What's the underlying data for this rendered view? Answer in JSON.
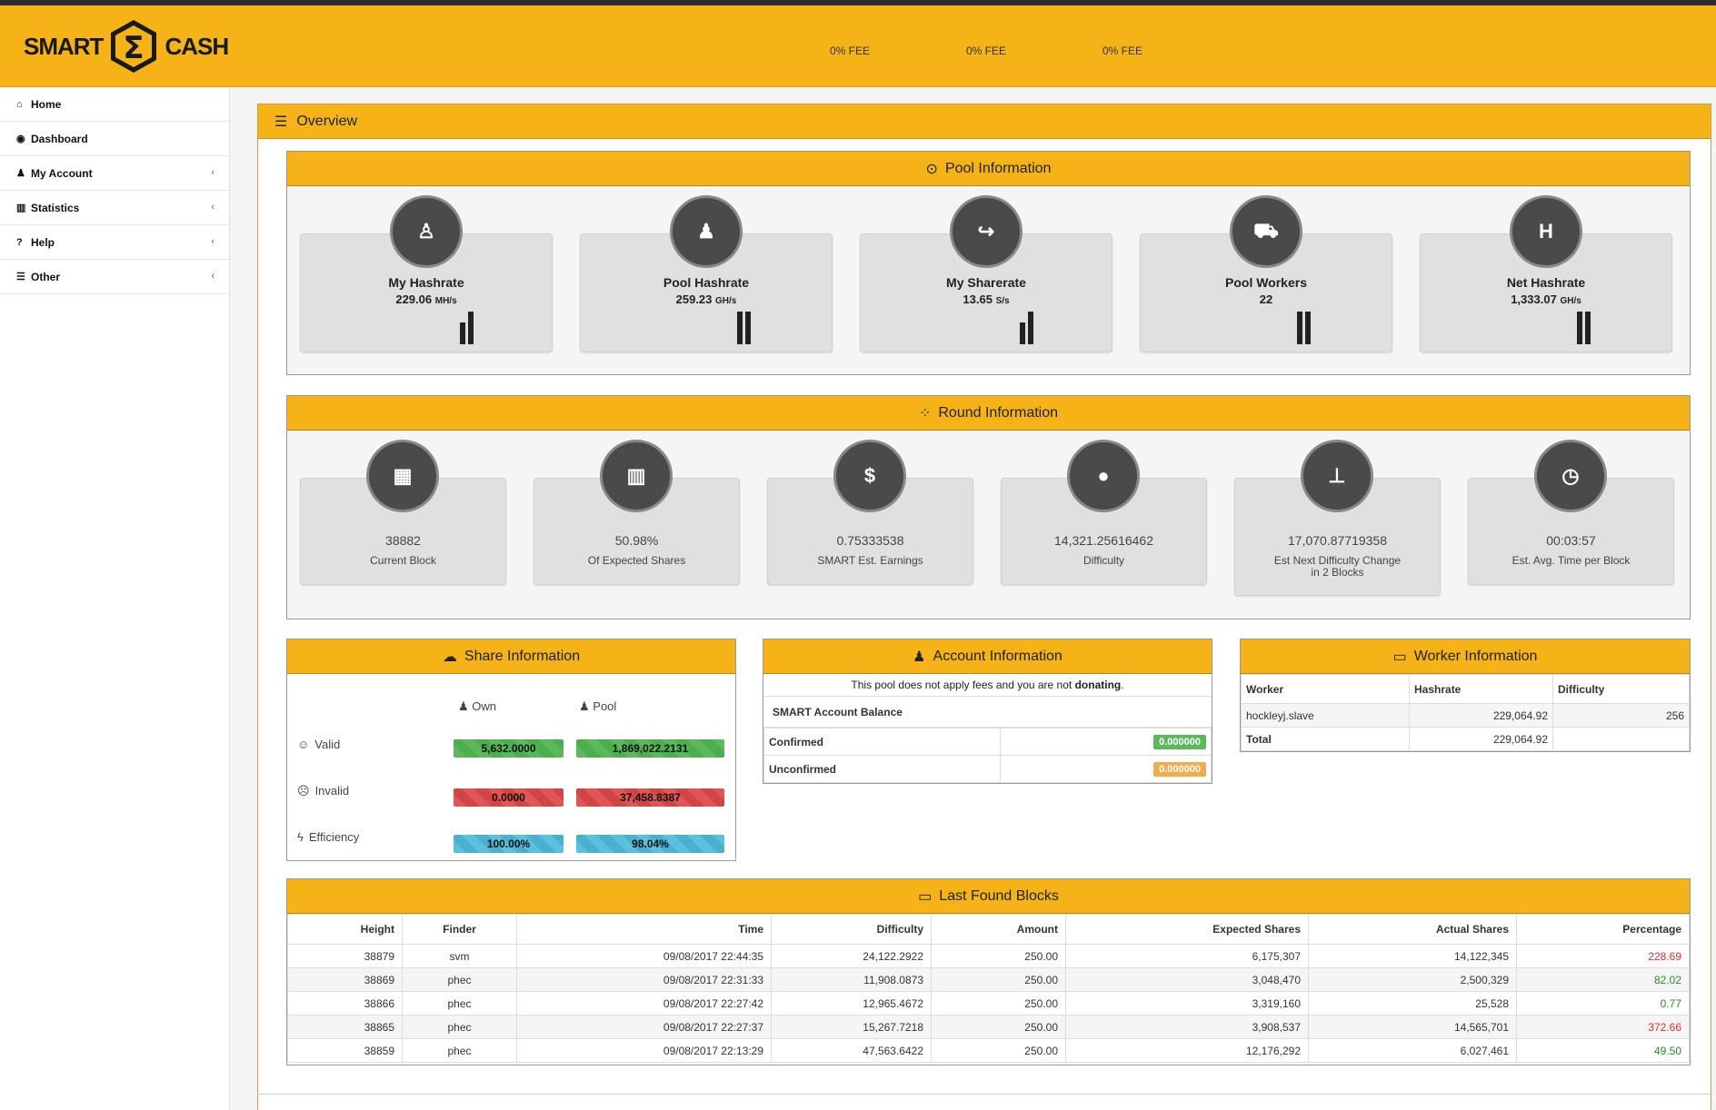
{
  "header": {
    "logo_left": "SMART",
    "logo_symbol": "Σ",
    "logo_right": "CASH",
    "fees": [
      "0% FEE",
      "0% FEE",
      "0% FEE"
    ]
  },
  "sidebar": {
    "items": [
      {
        "label": "Home",
        "icon": "home-icon",
        "glyph": "⌂",
        "chevron": false
      },
      {
        "label": "Dashboard",
        "icon": "dashboard-icon",
        "glyph": "◉",
        "chevron": false
      },
      {
        "label": "My Account",
        "icon": "user-money-icon",
        "glyph": "♟",
        "chevron": true
      },
      {
        "label": "Statistics",
        "icon": "bar-chart-icon",
        "glyph": "▥",
        "chevron": true
      },
      {
        "label": "Help",
        "icon": "question-icon",
        "glyph": "?",
        "chevron": true
      },
      {
        "label": "Other",
        "icon": "list-icon",
        "glyph": "☰",
        "chevron": true
      }
    ],
    "chevron_glyph": "‹"
  },
  "overview": {
    "title": "Overview"
  },
  "pool_info": {
    "title": "Pool Information",
    "tiles": [
      {
        "title": "My Hashrate",
        "value": "229.06",
        "unit": "MH/s",
        "icon": "male-icon",
        "glyph": "♙"
      },
      {
        "title": "Pool Hashrate",
        "value": "259.23",
        "unit": "GH/s",
        "icon": "users-icon",
        "glyph": "♟"
      },
      {
        "title": "My Sharerate",
        "value": "13.65",
        "unit": "S/s",
        "icon": "share-icon",
        "glyph": "↪"
      },
      {
        "title": "Pool Workers",
        "value": "22",
        "unit": "",
        "icon": "truck-icon",
        "glyph": "⛟"
      },
      {
        "title": "Net Hashrate",
        "value": "1,333.07",
        "unit": "GH/s",
        "icon": "h-square-icon",
        "glyph": "H"
      }
    ]
  },
  "round_info": {
    "title": "Round Information",
    "tiles": [
      {
        "value": "38882",
        "label": "Current Block",
        "icon": "th-large-icon",
        "glyph": "▦"
      },
      {
        "value": "50.98%",
        "label": "Of Expected Shares",
        "icon": "bar-chart-icon",
        "glyph": "▥"
      },
      {
        "value": "0.75333538",
        "label": "SMART Est. Earnings",
        "icon": "money-icon",
        "glyph": "$"
      },
      {
        "value": "14,321.25616462",
        "label": "Difficulty",
        "icon": "map-marker-icon",
        "glyph": "●"
      },
      {
        "value": "17,070.87719358",
        "label": "Est Next Difficulty Change in 2 Blocks",
        "icon": "sitemap-icon",
        "glyph": "⊥"
      },
      {
        "value": "00:03:57",
        "label": "Est. Avg. Time per Block",
        "icon": "clock-icon",
        "glyph": "◷"
      }
    ]
  },
  "share_info": {
    "title": "Share Information",
    "col_own": "Own",
    "col_pool": "Pool",
    "rows": [
      {
        "label": "Valid",
        "icon": "smile-icon",
        "glyph": "☺",
        "own": "5,632.0000",
        "pool": "1,869,022.2131",
        "color": "green"
      },
      {
        "label": "Invalid",
        "icon": "frown-icon",
        "glyph": "☹",
        "own": "0.0000",
        "pool": "37,458.8387",
        "color": "red"
      },
      {
        "label": "Efficiency",
        "icon": "bolt-icon",
        "glyph": "ϟ",
        "own": "100.00%",
        "pool": "98.04%",
        "color": "blue"
      }
    ]
  },
  "account_info": {
    "title": "Account Information",
    "notice_prefix": "This pool does not apply fees and you are not ",
    "notice_bold": "donating",
    "notice_suffix": ".",
    "balance_label": "SMART Account Balance",
    "confirmed_label": "Confirmed",
    "confirmed_value": "0.000000",
    "unconfirmed_label": "Unconfirmed",
    "unconfirmed_value": "0.000000"
  },
  "worker_info": {
    "title": "Worker Information",
    "headers": [
      "Worker",
      "Hashrate",
      "Difficulty"
    ],
    "rows": [
      [
        "hockleyj.slave",
        "229,064.92",
        "256"
      ]
    ],
    "total_label": "Total",
    "total_hashrate": "229,064.92"
  },
  "last_blocks": {
    "title": "Last Found Blocks",
    "headers": [
      "Height",
      "Finder",
      "Time",
      "Difficulty",
      "Amount",
      "Expected Shares",
      "Actual Shares",
      "Percentage"
    ],
    "rows": [
      [
        "38879",
        "svm",
        "09/08/2017 22:44:35",
        "24,122.2922",
        "250.00",
        "6,175,307",
        "14,122,345",
        "228.69"
      ],
      [
        "38869",
        "phec",
        "09/08/2017 22:31:33",
        "11,908.0873",
        "250.00",
        "3,048,470",
        "2,500,329",
        "82.02"
      ],
      [
        "38866",
        "phec",
        "09/08/2017 22:27:42",
        "12,965.4672",
        "250.00",
        "3,319,160",
        "25,528",
        "0.77"
      ],
      [
        "38865",
        "phec",
        "09/08/2017 22:27:37",
        "15,267.7218",
        "250.00",
        "3,908,537",
        "14,565,701",
        "372.66"
      ],
      [
        "38859",
        "phec",
        "09/08/2017 22:13:29",
        "47,563.6422",
        "250.00",
        "12,176,292",
        "6,027,461",
        "49.50"
      ]
    ],
    "pct_colors": [
      "#d9302c",
      "#2a8a2a",
      "#2a8a2a",
      "#d9302c",
      "#2a8a2a"
    ]
  },
  "colors": {
    "accent": "#f5b318",
    "valid": "#5cb85c",
    "invalid": "#e05555",
    "efficiency": "#5bc0de",
    "confirmed": "#5cb85c",
    "unconfirmed": "#f0ad4e"
  }
}
